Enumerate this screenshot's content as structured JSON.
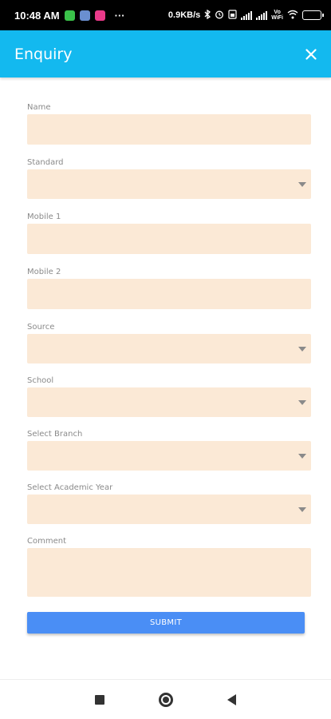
{
  "status_bar": {
    "time": "10:48 AM",
    "more": "···",
    "net_speed": "0.9KB/s",
    "icons": [
      "bluetooth-icon",
      "alarm-icon",
      "sim-icon",
      "signal-icon",
      "signal-icon",
      "vowifi-icon",
      "wifi-icon",
      "battery-icon"
    ],
    "app_icon_colors": [
      "#3ac24a",
      "#6a8fd0",
      "#ea3a8a"
    ],
    "battery_level": 1.0
  },
  "app_bar": {
    "title": "Enquiry",
    "close_icon": "close-icon",
    "color": "#13b9ef"
  },
  "form": {
    "field_color": "#fbe9d6",
    "fields": [
      {
        "label": "Name",
        "type": "text",
        "value": ""
      },
      {
        "label": "Standard",
        "type": "dropdown",
        "value": ""
      },
      {
        "label": "Mobile 1",
        "type": "text",
        "value": ""
      },
      {
        "label": "Mobile 2",
        "type": "text",
        "value": ""
      },
      {
        "label": "Source",
        "type": "dropdown",
        "value": ""
      },
      {
        "label": "School",
        "type": "dropdown",
        "value": ""
      },
      {
        "label": "Select Branch",
        "type": "dropdown",
        "value": ""
      },
      {
        "label": "Select Academic Year",
        "type": "dropdown",
        "value": ""
      },
      {
        "label": "Comment",
        "type": "textarea",
        "value": ""
      }
    ],
    "submit_label": "SUBMIT",
    "submit_color": "#4a8ef5"
  },
  "nav_bar": {
    "icons": [
      "recents-square-icon",
      "home-circle-icon",
      "back-triangle-icon"
    ]
  }
}
